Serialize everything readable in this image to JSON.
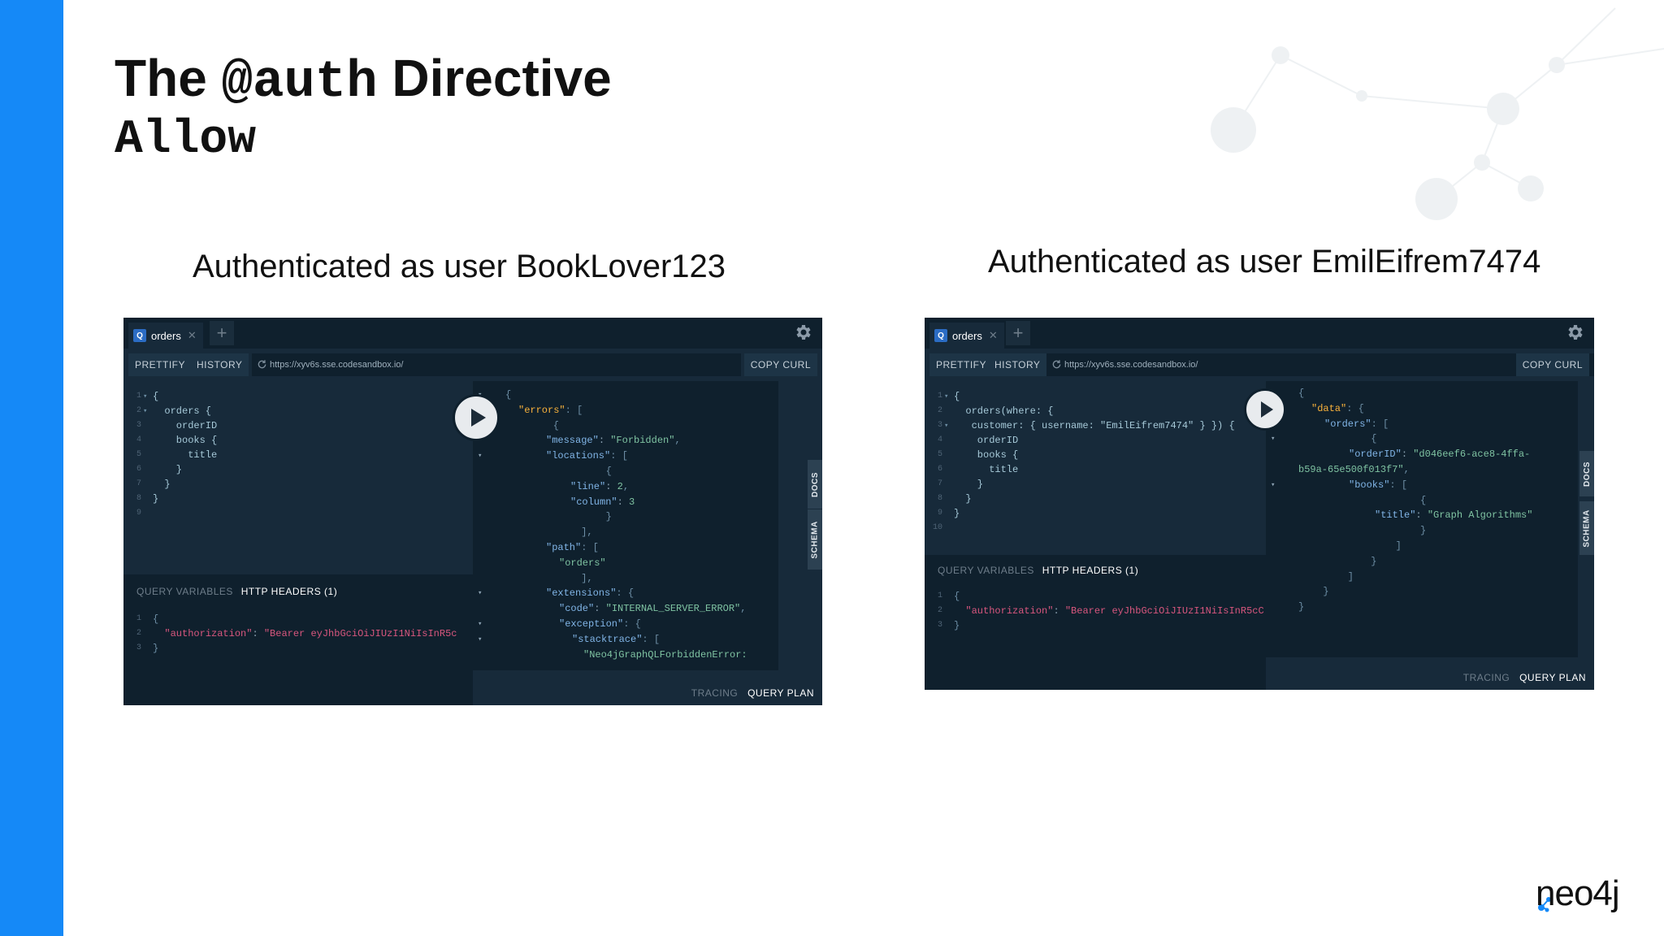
{
  "slide": {
    "title_pre": "The ",
    "title_code": "@auth",
    "title_post": " Directive",
    "subtitle": "Allow",
    "caption_left": "Authenticated as user BookLover123",
    "caption_right": "Authenticated as user EmilEifrem7474",
    "logo": "neo4j",
    "accent_color": "#1589F7"
  },
  "playground_left": {
    "tab_label": "orders",
    "tab_icon_letter": "Q",
    "prettify": "PRETTIFY",
    "history": "HISTORY",
    "url": "https://xyv6s.sse.codesandbox.io/",
    "copy_curl": "COPY CURL",
    "query_lines": [
      {
        "n": "1",
        "fold": "▾",
        "t": "{"
      },
      {
        "n": "2",
        "fold": "▾",
        "t": "  orders {"
      },
      {
        "n": "3",
        "fold": "",
        "t": "    orderID"
      },
      {
        "n": "4",
        "fold": "",
        "t": "    books {"
      },
      {
        "n": "5",
        "fold": "",
        "t": "      title"
      },
      {
        "n": "6",
        "fold": "",
        "t": "    }"
      },
      {
        "n": "7",
        "fold": "",
        "t": "  }"
      },
      {
        "n": "8",
        "fold": "",
        "t": "}"
      },
      {
        "n": "9",
        "fold": "",
        "t": ""
      }
    ],
    "query_variables": "QUERY VARIABLES",
    "http_headers": "HTTP HEADERS (1)",
    "header_lines": [
      {
        "n": "1",
        "t": "{"
      },
      {
        "n": "2",
        "key": "\"authorization\"",
        "val": "\"Bearer eyJhbGciOiJIUzI1NiIsInR5c"
      },
      {
        "n": "3",
        "t": "}"
      }
    ],
    "result_lines": [
      {
        "a": "▾",
        "t": "{"
      },
      {
        "a": "▾",
        "k": "\"errors\"",
        "t": ": ["
      },
      {
        "a": "▾",
        "t": "    {"
      },
      {
        "a": "",
        "k2": "\"message\"",
        "s": "\"Forbidden\"",
        "t": ","
      },
      {
        "a": "▾",
        "k2": "\"locations\"",
        "t": ": ["
      },
      {
        "a": "",
        "t": "        {"
      },
      {
        "a": "",
        "k2": "\"line\"",
        "s": "2",
        "t": ","
      },
      {
        "a": "",
        "k2": "\"column\"",
        "s": "3",
        "t": ""
      },
      {
        "a": "",
        "t": "        }"
      },
      {
        "a": "",
        "t": "      ],"
      },
      {
        "a": "",
        "k2": "\"path\"",
        "t": ": ["
      },
      {
        "a": "",
        "s": "\"orders\"",
        "t": ""
      },
      {
        "a": "",
        "t": "      ],"
      },
      {
        "a": "▾",
        "k2": "\"extensions\"",
        "t": ": {"
      },
      {
        "a": "",
        "k2": "\"code\"",
        "s": "\"INTERNAL_SERVER_ERROR\"",
        "t": ","
      },
      {
        "a": "▾",
        "k2": "\"exception\"",
        "t": ": {"
      },
      {
        "a": "▾",
        "k2": "\"stacktrace\"",
        "t": ": ["
      },
      {
        "a": "",
        "s": "\"Neo4jGraphQLForbiddenError:",
        "t": ""
      }
    ],
    "docs": "DOCS",
    "schema": "SCHEMA",
    "tracing": "TRACING",
    "query_plan": "QUERY PLAN"
  },
  "playground_right": {
    "tab_label": "orders",
    "tab_icon_letter": "Q",
    "prettify": "PRETTIFY",
    "history": "HISTORY",
    "url": "https://xyv6s.sse.codesandbox.io/",
    "copy_curl": "COPY CURL",
    "query_lines": [
      {
        "n": "1",
        "fold": "▾",
        "t": "{"
      },
      {
        "n": "2",
        "fold": "",
        "t": "  orders(where: {"
      },
      {
        "n": "3",
        "fold": "▾",
        "t": "   customer: { username: \"EmilEifrem7474\" } }) {"
      },
      {
        "n": "4",
        "fold": "",
        "t": "    orderID"
      },
      {
        "n": "5",
        "fold": "",
        "t": "    books {"
      },
      {
        "n": "6",
        "fold": "",
        "t": "      title"
      },
      {
        "n": "7",
        "fold": "",
        "t": "    }"
      },
      {
        "n": "8",
        "fold": "",
        "t": "  }"
      },
      {
        "n": "9",
        "fold": "",
        "t": "}"
      },
      {
        "n": "10",
        "fold": "",
        "t": ""
      }
    ],
    "query_variables": "QUERY VARIABLES",
    "http_headers": "HTTP HEADERS (1)",
    "header_lines": [
      {
        "n": "1",
        "t": "{"
      },
      {
        "n": "2",
        "key": "\"authorization\"",
        "val": "\"Bearer eyJhbGciOiJIUzI1NiIsInR5cC"
      },
      {
        "n": "3",
        "t": "}"
      }
    ],
    "result_lines": [
      {
        "a": "▾",
        "t": "{"
      },
      {
        "a": "▾",
        "k": "\"data\"",
        "t": ": {"
      },
      {
        "a": "▾",
        "k2": "\"orders\"",
        "t": ": ["
      },
      {
        "a": "▾",
        "t": "      {"
      },
      {
        "a": "",
        "k2": "\"orderID\"",
        "s": "\"d046eef6-ace8-4ffa-",
        "t": ""
      },
      {
        "a": "",
        "s": "b59a-65e500f013f7\"",
        "t": ","
      },
      {
        "a": "▾",
        "k2": "\"books\"",
        "t": ": ["
      },
      {
        "a": "",
        "t": "          {"
      },
      {
        "a": "",
        "k2": "\"title\"",
        "s": "\"Graph Algorithms\"",
        "t": ""
      },
      {
        "a": "",
        "t": "          }"
      },
      {
        "a": "",
        "t": "        ]"
      },
      {
        "a": "",
        "t": "      }"
      },
      {
        "a": "",
        "t": "    ]"
      },
      {
        "a": "",
        "t": "  }"
      },
      {
        "a": "",
        "t": "}"
      }
    ],
    "docs": "DOCS",
    "schema": "SCHEMA",
    "tracing": "TRACING",
    "query_plan": "QUERY PLAN"
  }
}
